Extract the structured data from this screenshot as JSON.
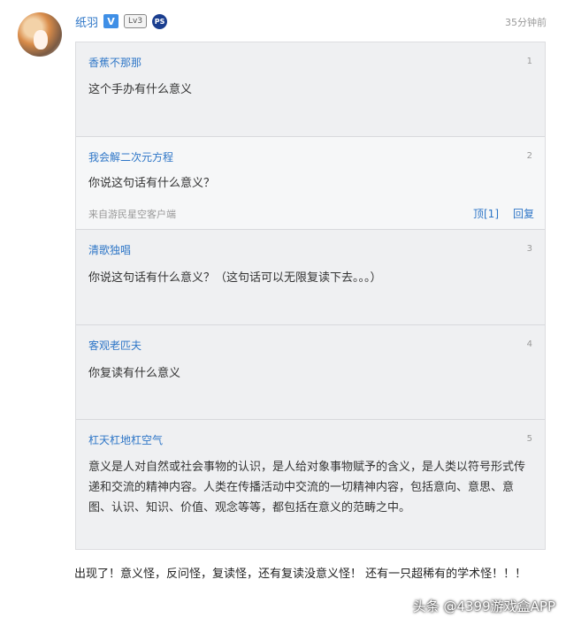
{
  "post": {
    "username": "纸羽",
    "verified_badge": "V",
    "level_badge": "Lv3",
    "platform_badge": "PS",
    "time": "35分钟前"
  },
  "floors": [
    {
      "name": "香蕉不那那",
      "num": "1",
      "text": "这个手办有什么意义"
    },
    {
      "name": "我会解二次元方程",
      "num": "2",
      "text": "你说这句话有什么意义？",
      "source": "来自游民星空客户端",
      "like": "顶[1]",
      "reply": "回复"
    },
    {
      "name": "清歌独唱",
      "num": "3",
      "text": "你说这句话有什么意义？（这句话可以无限复读下去。。。）"
    },
    {
      "name": "客观老匹夫",
      "num": "4",
      "text": "你复读有什么意义"
    },
    {
      "name": "杠天杠地杠空气",
      "num": "5",
      "text": "意义是人对自然或社会事物的认识，是人给对象事物赋予的含义，是人类以符号形式传递和交流的精神内容。人类在传播活动中交流的一切精神内容，包括意向、意思、意图、认识、知识、价值、观念等等，都包括在意义的范畴之中。"
    }
  ],
  "comment": "出现了！意义怪，反问怪，复读怪，还有复读没意义怪！ 还有一只超稀有的学术怪！！！",
  "watermark": "头条 @4399游戏盒APP",
  "colors": {
    "link": "#2e76c7",
    "quote_bg": "#eff0f2"
  }
}
